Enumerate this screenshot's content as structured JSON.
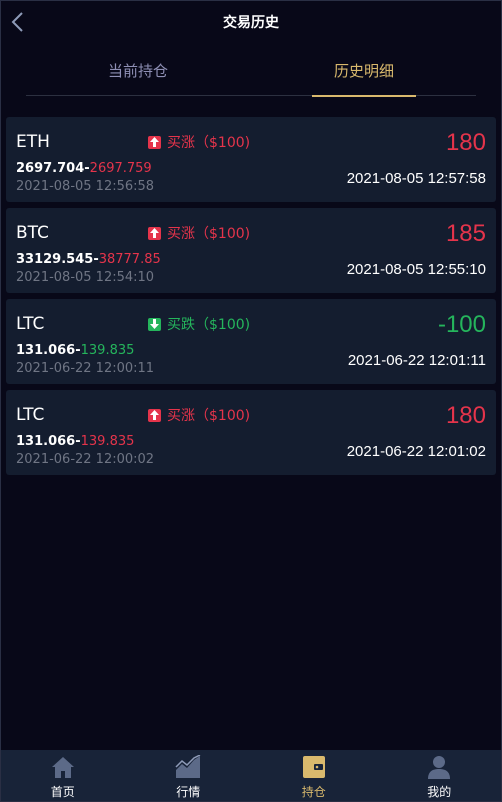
{
  "header": {
    "title": "交易历史",
    "back_icon": "chevron-left-icon"
  },
  "tabs": [
    {
      "label": "当前持仓",
      "active": false
    },
    {
      "label": "历史明细",
      "active": true
    }
  ],
  "colors": {
    "up": "#e5344b",
    "down": "#25b55c",
    "accent": "#d9b96d",
    "card": "#141d2f",
    "background": "#080818"
  },
  "trades": [
    {
      "symbol": "ETH",
      "direction": "up",
      "direction_label": "买涨（$100)",
      "open_price": "2697.704",
      "separator": "-",
      "close_price": "2697.759",
      "open_time": "2021-08-05 12:56:58",
      "profit": "180",
      "close_time": "2021-08-05 12:57:58"
    },
    {
      "symbol": "BTC",
      "direction": "up",
      "direction_label": "买涨（$100)",
      "open_price": "33129.545",
      "separator": "-",
      "close_price": "38777.85",
      "open_time": "2021-08-05 12:54:10",
      "profit": "185",
      "close_time": "2021-08-05 12:55:10"
    },
    {
      "symbol": "LTC",
      "direction": "down",
      "direction_label": "买跌（$100)",
      "open_price": "131.066",
      "separator": "-",
      "close_price": "139.835",
      "open_time": "2021-06-22 12:00:11",
      "profit": "-100",
      "close_time": "2021-06-22 12:01:11"
    },
    {
      "symbol": "LTC",
      "direction": "up",
      "direction_label": "买涨（$100)",
      "open_price": "131.066",
      "separator": "-",
      "close_price": "139.835",
      "open_time": "2021-06-22 12:00:02",
      "profit": "180",
      "close_time": "2021-06-22 12:01:02"
    }
  ],
  "bottom_nav": [
    {
      "label": "首页",
      "icon": "home-icon",
      "active": false
    },
    {
      "label": "行情",
      "icon": "chart-icon",
      "active": false
    },
    {
      "label": "持仓",
      "icon": "wallet-icon",
      "active": true
    },
    {
      "label": "我的",
      "icon": "user-icon",
      "active": false
    }
  ]
}
